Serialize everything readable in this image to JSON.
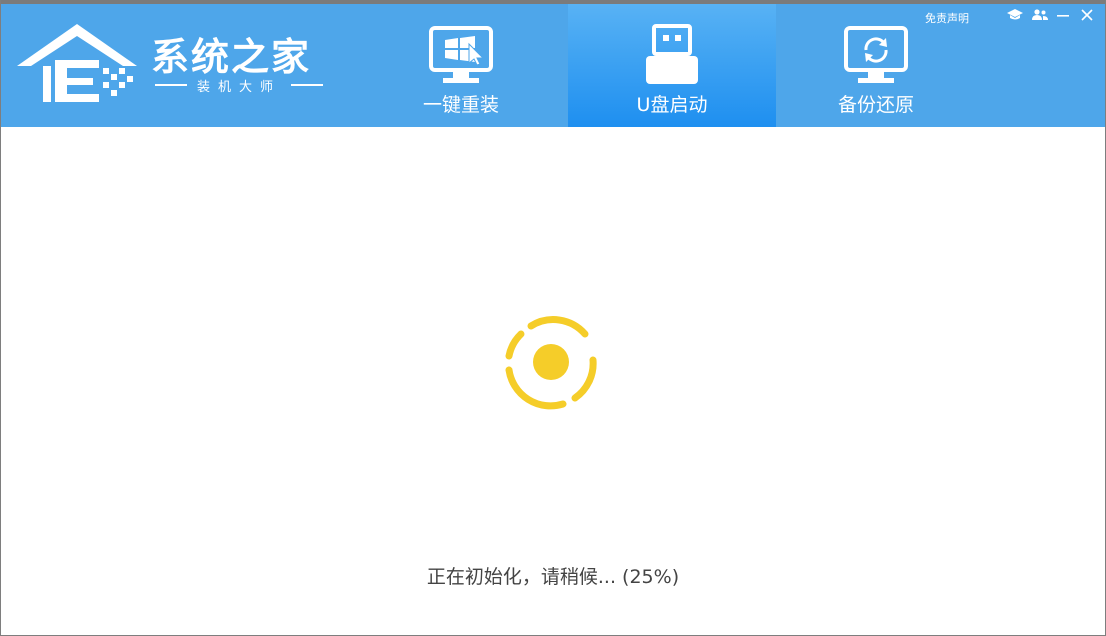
{
  "brand": {
    "title": "系统之家",
    "subtitle": "装机大师"
  },
  "tabs": [
    {
      "label": "一键重装",
      "icon": "windows-monitor-icon",
      "active": false
    },
    {
      "label": "U盘启动",
      "icon": "usb-drive-icon",
      "active": true
    },
    {
      "label": "备份还原",
      "icon": "backup-restore-icon",
      "active": false
    }
  ],
  "window_controls": {
    "disclaimer": "免责声明",
    "icons": [
      "graduation-cap-icon",
      "users-icon",
      "minimize-icon",
      "close-icon"
    ]
  },
  "main": {
    "status_text": "正在初始化，请稍候... (25%)",
    "progress_percent": 25
  },
  "colors": {
    "header": "#4ea6ea",
    "active_tab": "#1e8ff0",
    "spinner": "#f5cd29"
  }
}
